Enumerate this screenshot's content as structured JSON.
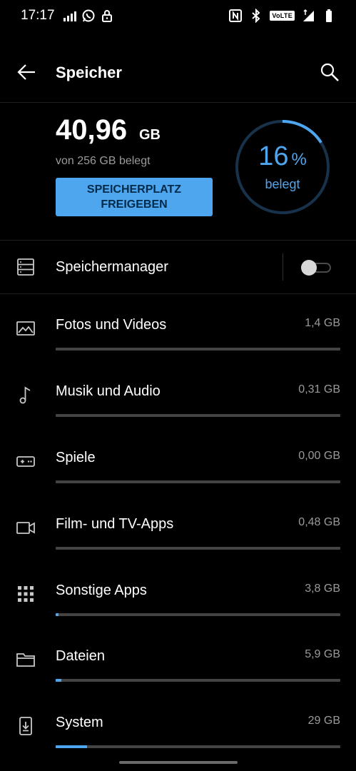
{
  "status_bar": {
    "time": "17:17",
    "volte": "VoLTE"
  },
  "header": {
    "title": "Speicher"
  },
  "summary": {
    "used_value": "40,96",
    "used_unit": "GB",
    "used_of": "von 256 GB belegt",
    "free_button_line1": "SPEICHERPLATZ",
    "free_button_line2": "FREIGEBEN",
    "percent_used": 16,
    "percent_text": "16",
    "percent_sign": "%",
    "percent_label": "belegt"
  },
  "manager": {
    "label": "Speichermanager",
    "enabled": false
  },
  "categories": [
    {
      "label": "Fotos und Videos",
      "size": "1,4 GB",
      "icon": "image-icon",
      "fraction": 0.0
    },
    {
      "label": "Musik und Audio",
      "size": "0,31 GB",
      "icon": "music-note-icon",
      "fraction": 0.0
    },
    {
      "label": "Spiele",
      "size": "0,00 GB",
      "icon": "gamepad-icon",
      "fraction": 0.0
    },
    {
      "label": "Film- und TV-Apps",
      "size": "0,48 GB",
      "icon": "video-camera-icon",
      "fraction": 0.0
    },
    {
      "label": "Sonstige Apps",
      "size": "3,8 GB",
      "icon": "apps-grid-icon",
      "fraction": 0.01
    },
    {
      "label": "Dateien",
      "size": "5,9 GB",
      "icon": "folder-icon",
      "fraction": 0.02
    },
    {
      "label": "System",
      "size": "29 GB",
      "icon": "system-update-icon",
      "fraction": 0.11
    }
  ],
  "colors": {
    "accent": "#4ea6ef",
    "background": "#000000",
    "muted_text": "#9a9a9a",
    "bar_track": "#444444"
  }
}
